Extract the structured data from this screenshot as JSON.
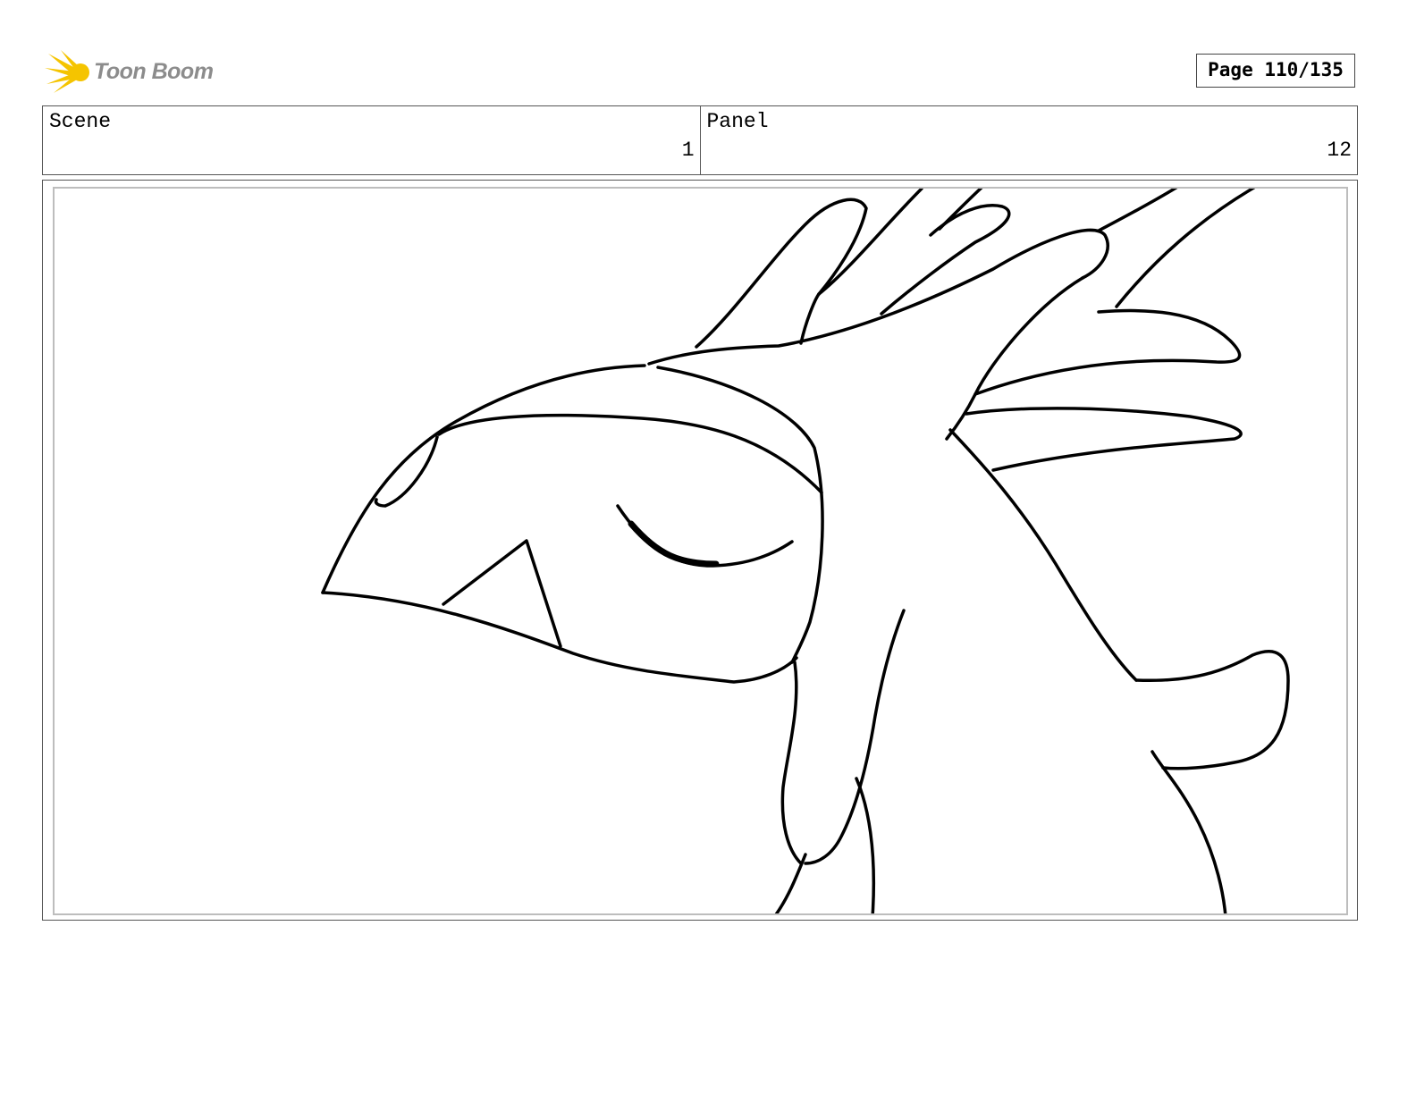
{
  "header": {
    "logo_text": "Toon Boom",
    "page_indicator": "Page 110/135"
  },
  "info": {
    "scene_label": "Scene",
    "scene_value": "1",
    "panel_label": "Panel",
    "panel_value": "12"
  },
  "colors": {
    "logo_star": "#f5c400",
    "logo_text": "#8c8c8c",
    "frame_border": "#555555",
    "safe_area_border": "#bdbdbd",
    "ink": "#000000"
  },
  "drawing": {
    "icon": "creature-sketch-icon"
  }
}
